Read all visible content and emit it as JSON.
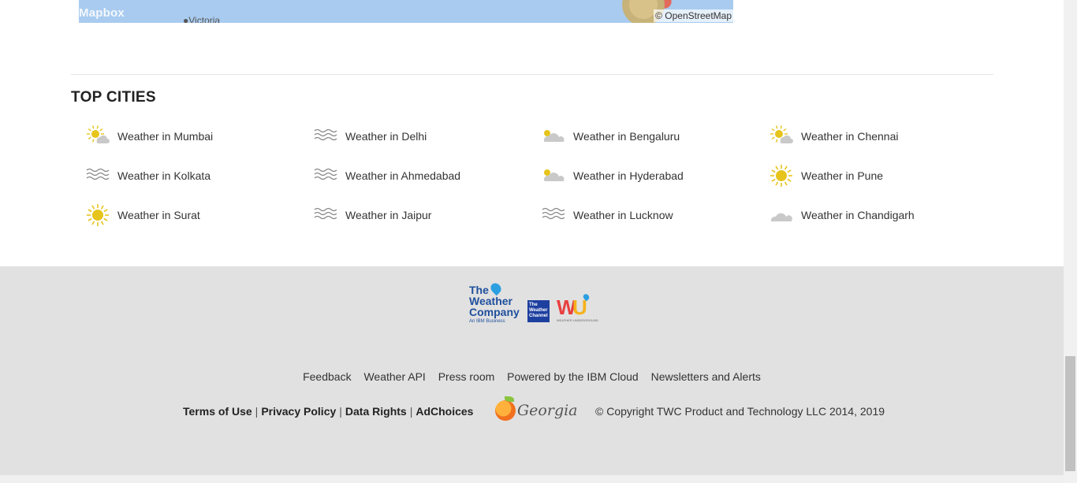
{
  "map": {
    "brand": "Mapbox",
    "place_label": "Victoria",
    "attribution": "© OpenStreetMap"
  },
  "top_cities": {
    "title": "TOP CITIES",
    "items": [
      {
        "label": "Weather in Mumbai",
        "icon": "partly-cloudy-sun-icon"
      },
      {
        "label": "Weather in Delhi",
        "icon": "haze-icon"
      },
      {
        "label": "Weather in Bengaluru",
        "icon": "mostly-cloudy-icon"
      },
      {
        "label": "Weather in Chennai",
        "icon": "partly-cloudy-sun-icon"
      },
      {
        "label": "Weather in Kolkata",
        "icon": "haze-icon"
      },
      {
        "label": "Weather in Ahmedabad",
        "icon": "haze-icon"
      },
      {
        "label": "Weather in Hyderabad",
        "icon": "mostly-cloudy-icon"
      },
      {
        "label": "Weather in Pune",
        "icon": "sun-icon"
      },
      {
        "label": "Weather in Surat",
        "icon": "sun-icon"
      },
      {
        "label": "Weather in Jaipur",
        "icon": "haze-icon"
      },
      {
        "label": "Weather in Lucknow",
        "icon": "haze-icon"
      },
      {
        "label": "Weather in Chandigarh",
        "icon": "cloud-icon"
      }
    ]
  },
  "footer": {
    "logos": {
      "twc_company_line1": "The",
      "twc_company_line2": "Weather",
      "twc_company_line3": "Company",
      "twc_company_sub": "An IBM Business",
      "twc_channel": "The Weather Channel",
      "wu_sub": "WEATHER UNDERGROUND"
    },
    "links": [
      "Feedback",
      "Weather API",
      "Press room",
      "Powered by the IBM Cloud",
      "Newsletters and Alerts"
    ],
    "legal": [
      "Terms of Use",
      "Privacy Policy",
      "Data Rights",
      "AdChoices"
    ],
    "georgia": "Georgia",
    "copyright": "© Copyright TWC Product and Technology LLC 2014, 2019"
  },
  "colors": {
    "footer_bg": "#e1e1e1",
    "sun": "#e6c41c",
    "cloud": "#c9c9c9",
    "haze": "#8a8a8a",
    "twc_blue": "#1f4f9d"
  }
}
